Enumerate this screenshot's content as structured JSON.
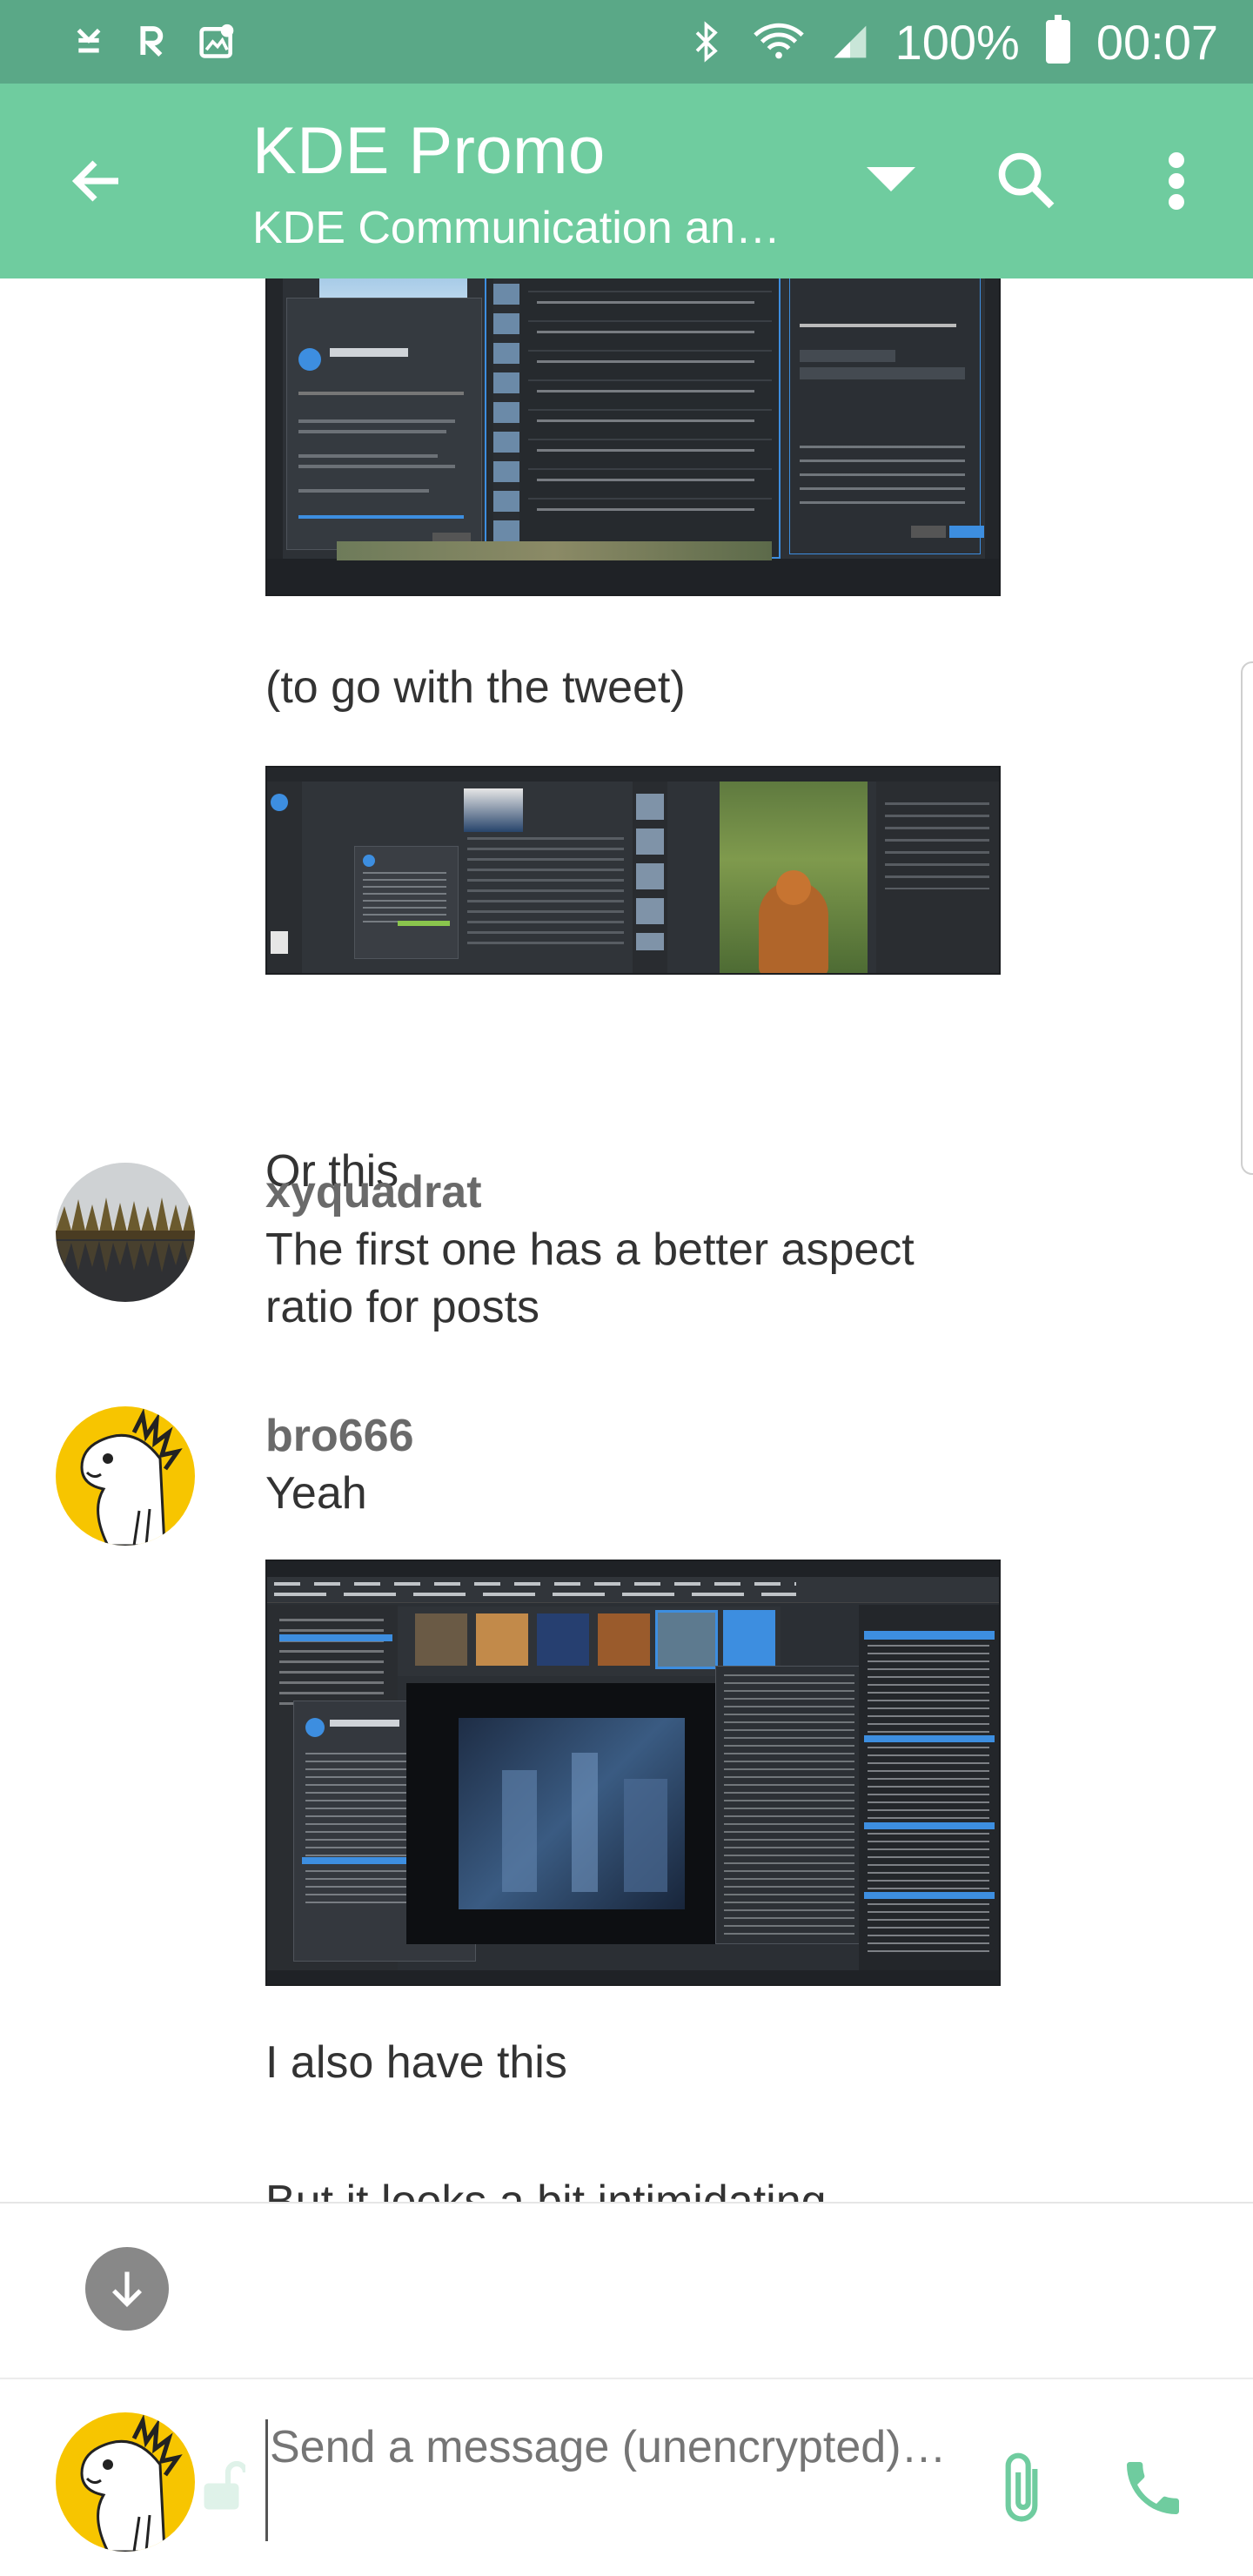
{
  "status_bar": {
    "battery": "100%",
    "time": "00:07",
    "icons": [
      "download-done-icon",
      "app-r-icon",
      "image-location-icon",
      "bluetooth-icon",
      "wifi-icon",
      "signal-icon",
      "battery-icon"
    ]
  },
  "app_bar": {
    "title": "KDE Promo",
    "subtitle": "KDE Communication an…",
    "icons": [
      "back-arrow-icon",
      "dropdown-triangle-icon",
      "search-icon",
      "more-vert-icon"
    ]
  },
  "timeline": {
    "messages": [
      {
        "type": "image",
        "description": "digiKam screenshot with About dialog and time adjust panel"
      },
      {
        "type": "text",
        "body": "(to go with the tweet)"
      },
      {
        "type": "image",
        "description": "digiKam screenshot with dog photo"
      },
      {
        "type": "text",
        "body": "Or this"
      },
      {
        "type": "text",
        "sender": "xyquadrat",
        "body_line1": "The first one has a better aspect",
        "body_line2": "ratio for posts"
      },
      {
        "type": "text",
        "sender": "bro666",
        "body": "Yeah"
      },
      {
        "type": "image",
        "description": "digiKam main window screenshot"
      },
      {
        "type": "text",
        "body": "I also have this"
      },
      {
        "type": "text",
        "body": "But it looks a bit intimidating"
      }
    ]
  },
  "composer": {
    "placeholder": "Send a message (unencrypted)…",
    "accent_color": "#6fcc9f"
  },
  "colors": {
    "status_bar": "#5aa887",
    "app_bar": "#6fcc9f",
    "accent_icon": "#6fcc9f"
  }
}
